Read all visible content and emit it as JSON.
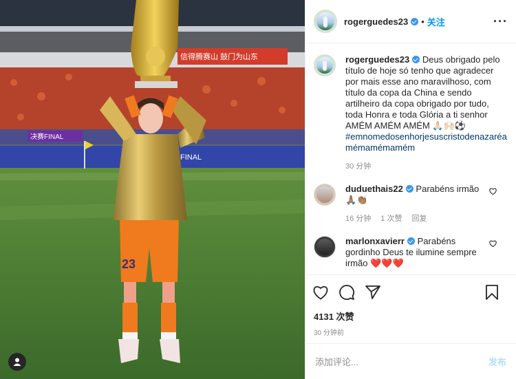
{
  "post": {
    "username": "rogerguedes23",
    "follow_label": "关注",
    "separator": "•",
    "more_label": "···"
  },
  "caption": {
    "username": "rogerguedes23",
    "text": "Deus obrigado pelo título de hoje só tenho que agradecer por mais esse ano maravilhoso, com título da copa da China e sendo artilheiro da copa obrigado por tudo, toda Honra e toda Glória a ti senhor AMÉM AMÉM AMÉM 🙏🏻🙌🏻⚽",
    "hashtag": "#emnomedosenhorjesuscristodenazaréamémamémamém",
    "time": "30 分钟"
  },
  "comments": [
    {
      "username": "duduethais22",
      "text": "Parabéns irmão",
      "emoji": "🙏🏽👏🏽",
      "time": "16 分钟",
      "likes": "1 次赞",
      "reply": "回复"
    },
    {
      "username": "marlonxavierr",
      "text": "Parabéns gordinho Deus te ilumine sempre irmão",
      "emoji": "❤️❤️❤️"
    }
  ],
  "stats": {
    "likes": "4131 次赞",
    "time": "30 分钟前"
  },
  "add_comment": {
    "placeholder": "添加评论...",
    "post_label": "发布"
  },
  "photo": {
    "jersey_number": "23",
    "banner_text_1": "决赛FINAL",
    "banner_text_2": "信得腾赛山 鼓门为山东",
    "banner_text_3": "FINAL"
  },
  "colors": {
    "accent": "#0095f6",
    "verified": "#3897f0",
    "heart": "#ed4956",
    "kit_orange": "#f07a1e",
    "gold": "#c9a13a"
  }
}
